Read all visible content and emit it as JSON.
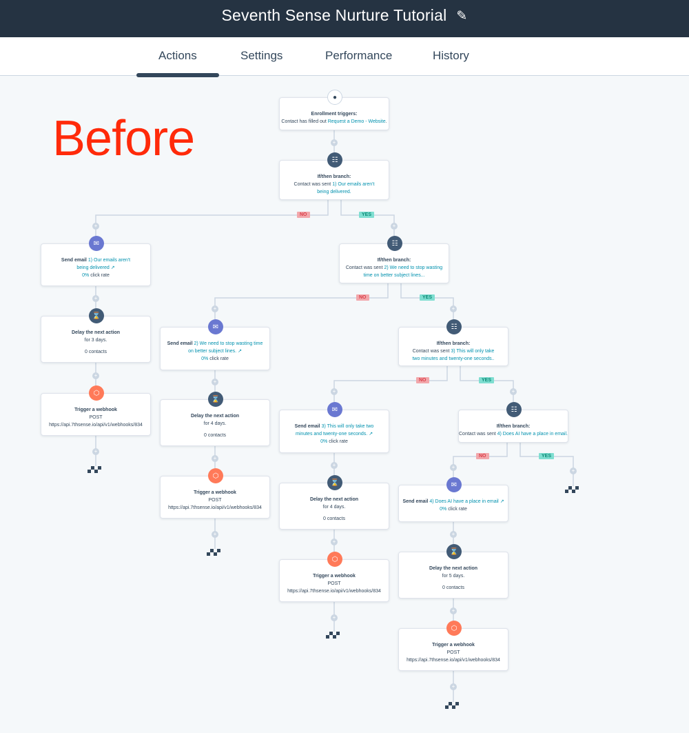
{
  "header": {
    "title": "Seventh Sense Nurture Tutorial",
    "edit_icon": "pencil-icon"
  },
  "tabs": [
    {
      "label": "Actions",
      "active": true
    },
    {
      "label": "Settings",
      "active": false
    },
    {
      "label": "Performance",
      "active": false
    },
    {
      "label": "History",
      "active": false
    }
  ],
  "annotation": "Before",
  "branch_labels": {
    "no": "NO",
    "yes": "YES"
  },
  "colors": {
    "topbar": "#253342",
    "link": "#0091ae",
    "email_icon": "#6a78d1",
    "webhook_icon": "#ff7a59",
    "branch_icon": "#425b76",
    "no_tag": "#f2a7ab",
    "yes_tag": "#7fded1",
    "annotation": "#ff2a0a"
  },
  "workflow": {
    "trigger": {
      "head": "Enrollment triggers:",
      "prefix": "Contact has filled out ",
      "link": "Request a Demo - Website",
      "suffix": "."
    },
    "branch1": {
      "head": "If/then branch:",
      "prefix": "Contact was sent ",
      "link": "1) Our emails aren't being delivered."
    },
    "branch2": {
      "head": "If/then branch:",
      "prefix": "Contact was sent ",
      "link": "2) We need to stop wasting time on better subject lines..."
    },
    "branch3": {
      "head": "If/then branch:",
      "prefix": "Contact was sent ",
      "link": "3) This will only take two minutes and twenty-one seconds.."
    },
    "branch4": {
      "head": "If/then branch:",
      "prefix": "Contact was sent ",
      "link": "4) Does AI have a place in email."
    },
    "email1": {
      "head": "Send email ",
      "link": "1) Our emails aren't being delivered",
      "rate": "0%",
      "rate_label": " click rate"
    },
    "email2": {
      "head": "Send email ",
      "link": "2) We need to stop wasting time on better subject lines.",
      "rate": "0%",
      "rate_label": " click rate"
    },
    "email3": {
      "head": "Send email ",
      "link": "3) This will only take two minutes and twenty-one seconds.",
      "rate": "0%",
      "rate_label": " click rate"
    },
    "email4": {
      "head": "Send email ",
      "link": "4) Does AI have a place in email",
      "rate": "0%",
      "rate_label": " click rate"
    },
    "delay1": {
      "head": "Delay the next action",
      "duration": "for 3 days.",
      "contacts": "0 contacts"
    },
    "delay2": {
      "head": "Delay the next action",
      "duration": "for 4 days.",
      "contacts": "0 contacts"
    },
    "delay3": {
      "head": "Delay the next action",
      "duration": "for 4 days.",
      "contacts": "0 contacts"
    },
    "delay4": {
      "head": "Delay the next action",
      "duration": "for 5 days.",
      "contacts": "0 contacts"
    },
    "webhook1": {
      "head": "Trigger a webhook",
      "method": "POST",
      "url": "https://api.7thsense.io/api/v1/webhooks/834"
    },
    "webhook2": {
      "head": "Trigger a webhook",
      "method": "POST",
      "url": "https://api.7thsense.io/api/v1/webhooks/834"
    },
    "webhook3": {
      "head": "Trigger a webhook",
      "method": "POST",
      "url": "https://api.7thsense.io/api/v1/webhooks/834"
    },
    "webhook4": {
      "head": "Trigger a webhook",
      "method": "POST",
      "url": "https://api.7thsense.io/api/v1/webhooks/834"
    }
  }
}
